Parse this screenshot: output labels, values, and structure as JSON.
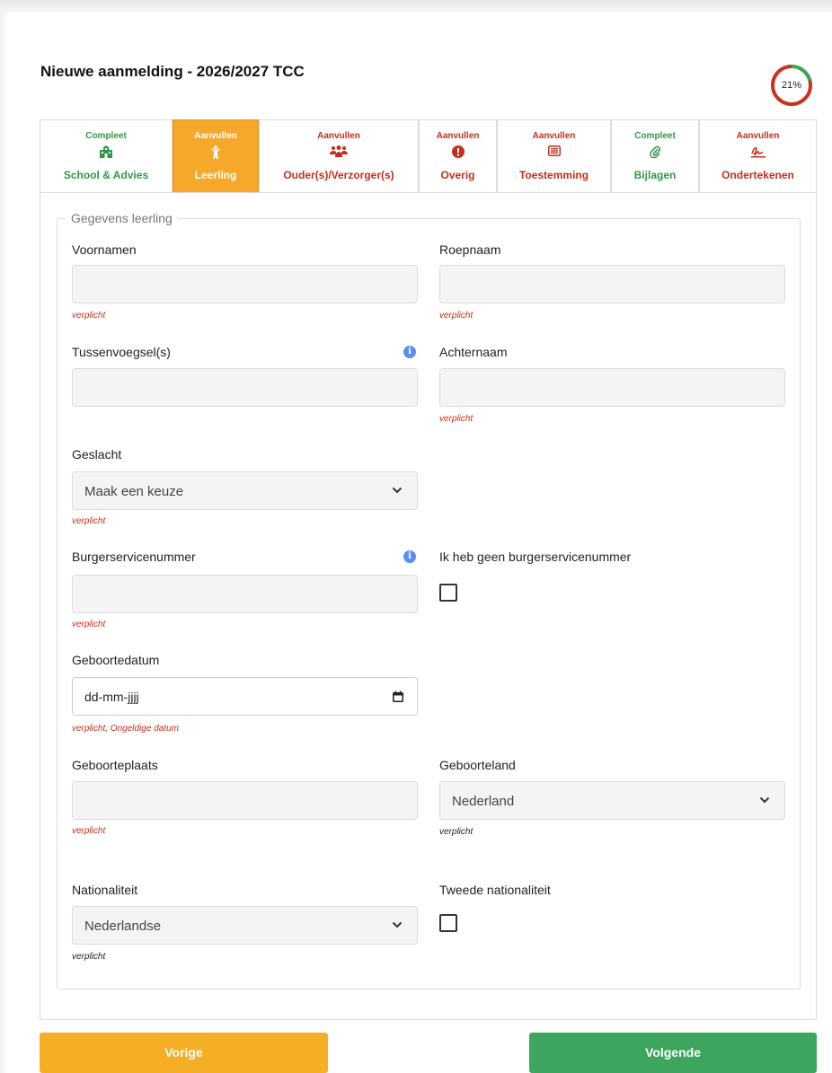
{
  "header": {
    "title": "Nieuwe aanmelding - 2026/2027 TCC",
    "progress_label": "21%",
    "progress_value": 0.21
  },
  "tabs": [
    {
      "status": "Compleet",
      "label": "School & Advies",
      "icon": "school-icon",
      "state": "complete"
    },
    {
      "status": "Aanvullen",
      "label": "Leerling",
      "icon": "child-icon",
      "state": "active"
    },
    {
      "status": "Aanvullen",
      "label": "Ouder(s)/Verzorger(s)",
      "icon": "users-icon",
      "state": "incomplete"
    },
    {
      "status": "Aanvullen",
      "label": "Overig",
      "icon": "alert-icon",
      "state": "incomplete"
    },
    {
      "status": "Aanvullen",
      "label": "Toestemming",
      "icon": "list-icon",
      "state": "incomplete"
    },
    {
      "status": "Compleet",
      "label": "Bijlagen",
      "icon": "paperclip-icon",
      "state": "complete"
    },
    {
      "status": "Aanvullen",
      "label": "Ondertekenen",
      "icon": "signature-icon",
      "state": "incomplete"
    }
  ],
  "form": {
    "legend": "Gegevens leerling",
    "voornamen": {
      "label": "Voornamen",
      "value": "",
      "hint": "verplicht"
    },
    "roepnaam": {
      "label": "Roepnaam",
      "value": "",
      "hint": "verplicht"
    },
    "tussenvoegsel": {
      "label": "Tussenvoegsel(s)",
      "value": ""
    },
    "achternaam": {
      "label": "Achternaam",
      "value": "",
      "hint": "verplicht"
    },
    "geslacht": {
      "label": "Geslacht",
      "value": "Maak een keuze",
      "hint": "verplicht"
    },
    "bsn": {
      "label": "Burgerservicenummer",
      "value": "",
      "hint": "verplicht"
    },
    "geen_bsn": {
      "label": "Ik heb geen burgerservicenummer",
      "checked": false
    },
    "geboortedatum": {
      "label": "Geboortedatum",
      "value": "dd-mm-jjjj",
      "hint": "verplicht, Ongeldige datum"
    },
    "geboorteplaats": {
      "label": "Geboorteplaats",
      "value": "",
      "hint": "verplicht"
    },
    "geboorteland": {
      "label": "Geboorteland",
      "value": "Nederland",
      "hint": "verplicht"
    },
    "nationaliteit": {
      "label": "Nationaliteit",
      "value": "Nederlandse",
      "hint": "verplicht"
    },
    "tweede_nationaliteit": {
      "label": "Tweede nationaliteit",
      "checked": false
    }
  },
  "buttons": {
    "prev": "Vorige",
    "next": "Volgende"
  },
  "colors": {
    "accent": "#f6a82a",
    "complete": "#2e9a47",
    "incomplete": "#c42f1c",
    "next": "#3da55d"
  }
}
